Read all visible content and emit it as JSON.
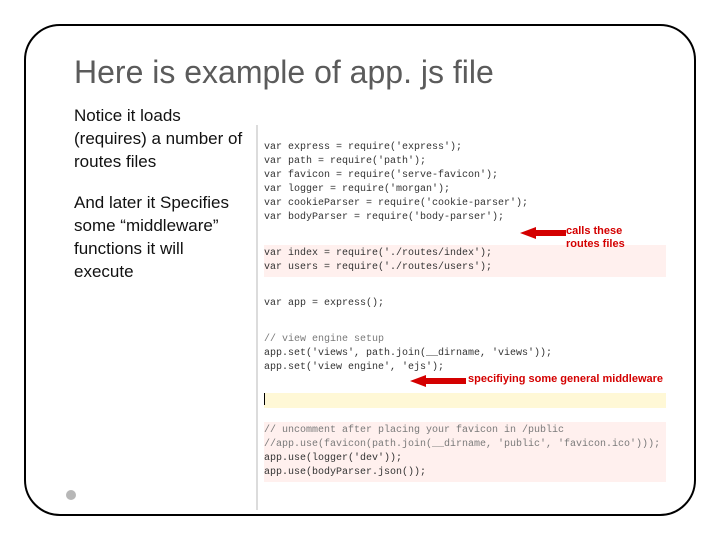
{
  "title": "Here is example of app. js file",
  "left": {
    "p1": "Notice it loads (requires) a number of routes files",
    "p2": "And later it Specifies some “middleware” functions it will execute"
  },
  "annot": {
    "a1": "calls these routes files",
    "a2": "specifiying some general middleware"
  },
  "code": {
    "l1": "var express = require('express');",
    "l2": "var path = require('path');",
    "l3": "var favicon = require('serve-favicon');",
    "l4": "var logger = require('morgan');",
    "l5": "var cookieParser = require('cookie-parser');",
    "l6": "var bodyParser = require('body-parser');",
    "l7": "var index = require('./routes/index');",
    "l8": "var users = require('./routes/users');",
    "l9": "var app = express();",
    "l10": "// view engine setup",
    "l11": "app.set('views', path.join(__dirname, 'views'));",
    "l12": "app.set('view engine', 'ejs');",
    "l13": "// uncomment after placing your favicon in /public",
    "l14": "//app.use(favicon(path.join(__dirname, 'public', 'favicon.ico')));",
    "l15": "app.use(logger('dev'));",
    "l16": "app.use(bodyParser.json());"
  }
}
